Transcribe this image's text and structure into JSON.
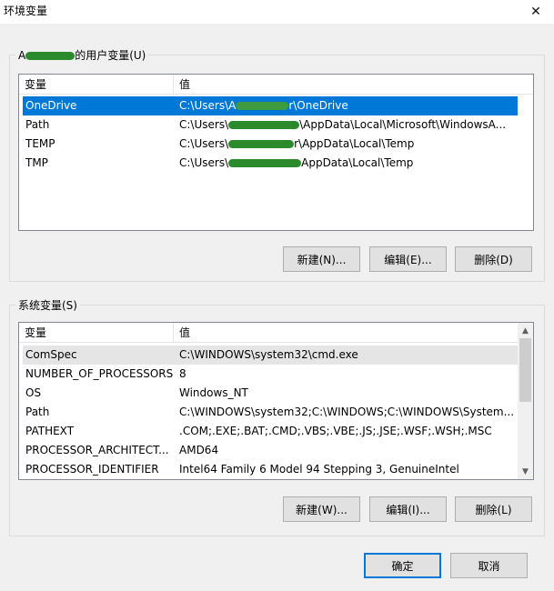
{
  "window": {
    "title": "环境变量",
    "close_glyph": "✕"
  },
  "user_vars": {
    "group_label_prefix": "A",
    "group_label_suffix": "的用户变量(U)",
    "col_var": "变量",
    "col_val": "值",
    "rows": [
      {
        "name": "OneDrive",
        "val_a": "C:\\Users\\A",
        "val_b": "r\\OneDrive"
      },
      {
        "name": "Path",
        "val_a": "C:\\Users\\",
        "val_b": "\\AppData\\Local\\Microsoft\\WindowsA..."
      },
      {
        "name": "TEMP",
        "val_a": "C:\\Users\\",
        "val_b": "r\\AppData\\Local\\Temp"
      },
      {
        "name": "TMP",
        "val_a": "C:\\Users\\",
        "val_b": "AppData\\Local\\Temp"
      }
    ],
    "new_label": "新建(N)...",
    "edit_label": "编辑(E)...",
    "delete_label": "删除(D)"
  },
  "system_vars": {
    "group_label": "系统变量(S)",
    "col_var": "变量",
    "col_val": "值",
    "rows": [
      {
        "name": "ComSpec",
        "value": "C:\\WINDOWS\\system32\\cmd.exe"
      },
      {
        "name": "NUMBER_OF_PROCESSORS",
        "value": "8"
      },
      {
        "name": "OS",
        "value": "Windows_NT"
      },
      {
        "name": "Path",
        "value": "C:\\WINDOWS\\system32;C:\\WINDOWS;C:\\WINDOWS\\System..."
      },
      {
        "name": "PATHEXT",
        "value": ".COM;.EXE;.BAT;.CMD;.VBS;.VBE;.JS;.JSE;.WSF;.WSH;.MSC"
      },
      {
        "name": "PROCESSOR_ARCHITECT...",
        "value": "AMD64"
      },
      {
        "name": "PROCESSOR_IDENTIFIER",
        "value": "Intel64 Family 6 Model 94 Stepping 3, GenuineIntel"
      }
    ],
    "new_label": "新建(W)...",
    "edit_label": "编辑(I)...",
    "delete_label": "删除(L)"
  },
  "footer": {
    "ok_label": "确定",
    "cancel_label": "取消"
  },
  "colors": {
    "selection": "#0078d7",
    "redaction": "#2b8a2b"
  }
}
